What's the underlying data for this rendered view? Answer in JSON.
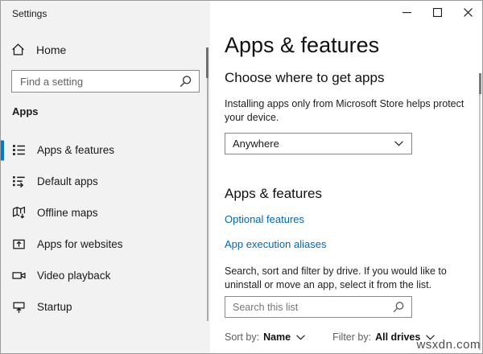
{
  "window": {
    "title": "Settings"
  },
  "sidebar": {
    "home_label": "Home",
    "search_placeholder": "Find a setting",
    "section_label": "Apps",
    "items": [
      {
        "label": "Apps & features",
        "selected": true
      },
      {
        "label": "Default apps",
        "selected": false
      },
      {
        "label": "Offline maps",
        "selected": false
      },
      {
        "label": "Apps for websites",
        "selected": false
      },
      {
        "label": "Video playback",
        "selected": false
      },
      {
        "label": "Startup",
        "selected": false
      }
    ]
  },
  "main": {
    "page_title": "Apps & features",
    "get_apps": {
      "heading": "Choose where to get apps",
      "description": "Installing apps only from Microsoft Store helps protect your device.",
      "dropdown_value": "Anywhere"
    },
    "apps_features": {
      "heading": "Apps & features",
      "links": {
        "0": "Optional features",
        "1": "App execution aliases"
      },
      "description": "Search, sort and filter by drive. If you would like to uninstall or move an app, select it from the list.",
      "search_placeholder": "Search this list",
      "sort_label": "Sort by:",
      "sort_value": "Name",
      "filter_label": "Filter by:",
      "filter_value": "All drives"
    }
  },
  "watermark": "wsxdn.com",
  "colors": {
    "accent": "#0078d7",
    "link": "#0067b8"
  }
}
